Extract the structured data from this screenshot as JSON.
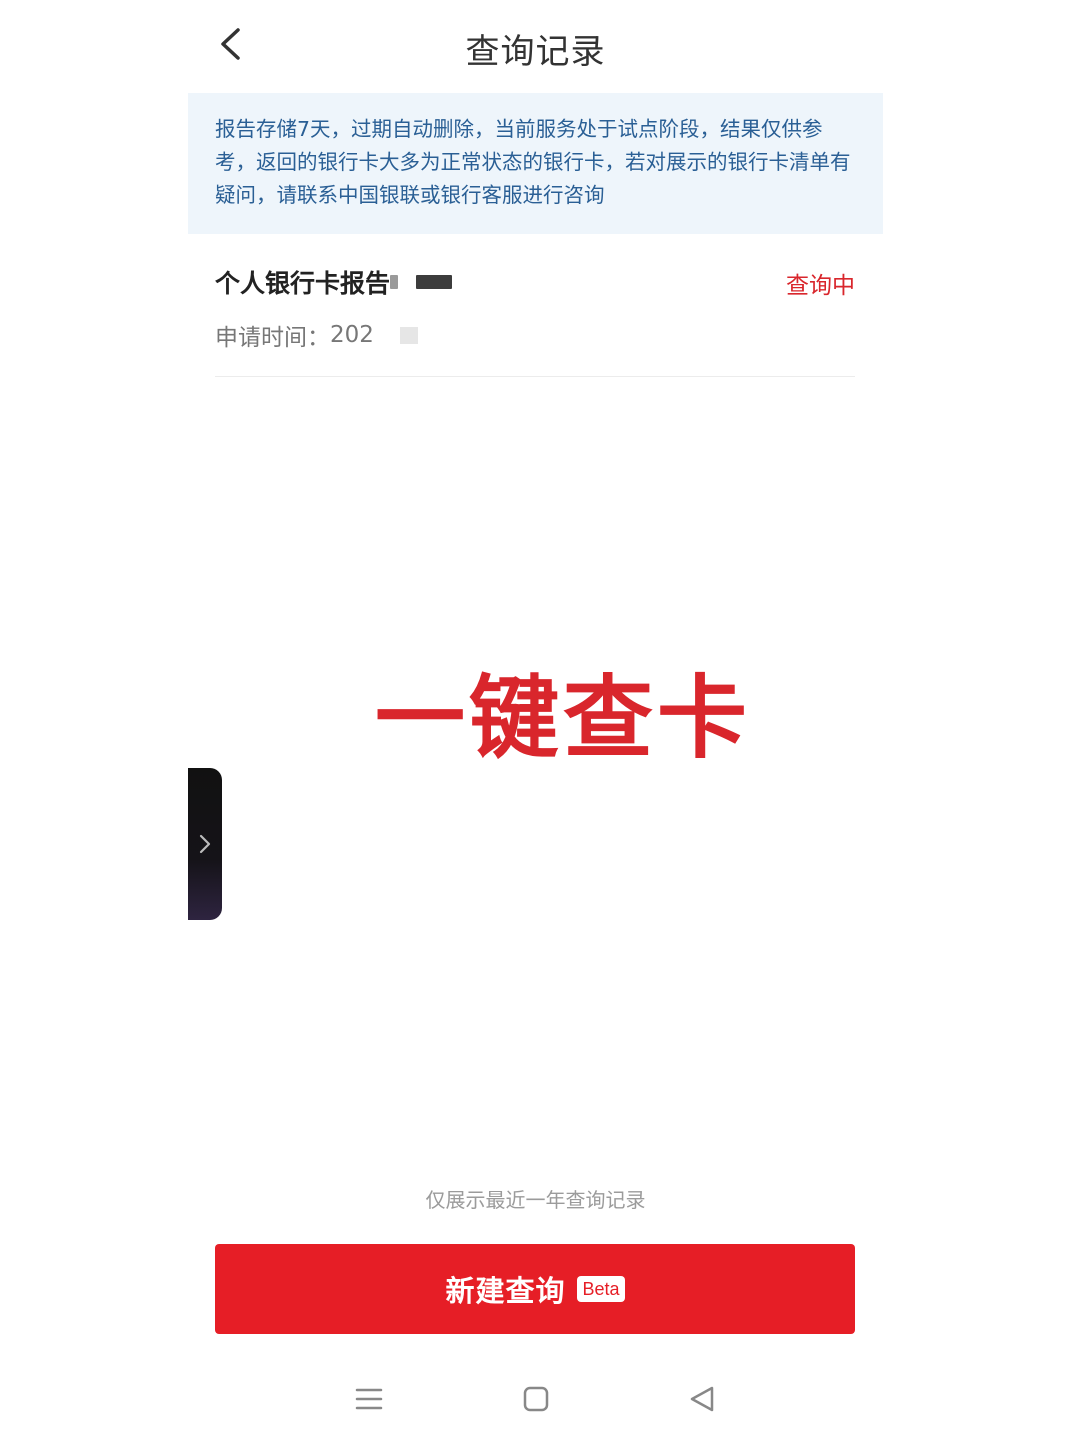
{
  "header": {
    "title": "查询记录",
    "back_icon": "chevron-left-icon"
  },
  "notice": {
    "text": "报告存储7天，过期自动删除，当前服务处于试点阶段，结果仅供参考，返回的银行卡大多为正常状态的银行卡，若对展示的银行卡清单有疑问，请联系中国银联或银行客服进行咨询"
  },
  "record": {
    "title": "个人银行卡报告",
    "status": "查询中",
    "time_label": "申请时间：",
    "time_value": "202"
  },
  "overlay": {
    "text": "一键查卡"
  },
  "side_handle": {
    "icon": "chevron-right-icon"
  },
  "footer": {
    "note": "仅展示最近一年查询记录",
    "button_label": "新建查询",
    "badge": "Beta"
  },
  "navbar": {
    "menu_icon": "menu-icon",
    "home_icon": "home-square-icon",
    "back_icon": "back-triangle-icon"
  },
  "colors": {
    "accent_red": "#e61e26",
    "status_red": "#d9262c",
    "notice_bg": "#eef5fb",
    "notice_text": "#2a5f95"
  }
}
